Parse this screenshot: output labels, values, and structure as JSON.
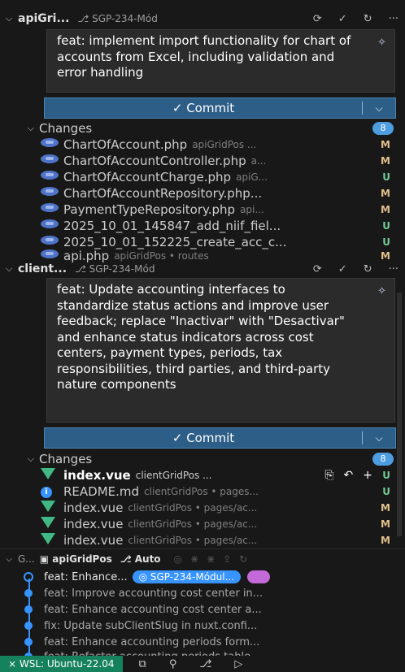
{
  "repos": [
    {
      "name": "apiGri...",
      "branch": "SGP-234-Mód",
      "commit_message": "feat: implement import functionality for chart of accounts from Excel, including validation and error handling",
      "commit_label": "Commit",
      "changes_label": "Changes",
      "changes_count": "8",
      "files": [
        {
          "name": "ChartOfAccount.php",
          "path": "apiGridPos ...",
          "status": "M"
        },
        {
          "name": "ChartOfAccountController.php",
          "path": "a...",
          "status": "M"
        },
        {
          "name": "ChartOfAccountCharge.php",
          "path": "apiG...",
          "status": "U"
        },
        {
          "name": "ChartOfAccountRepository.php...",
          "path": "",
          "status": "M"
        },
        {
          "name": "PaymentTypeRepository.php",
          "path": "api...",
          "status": "M"
        },
        {
          "name": "2025_10_01_145847_add_niif_fiel...",
          "path": "",
          "status": "U"
        },
        {
          "name": "2025_10_01_152225_create_acc_c...",
          "path": "",
          "status": "U"
        },
        {
          "name": "api.php",
          "path": "apiGridPos • routes",
          "status": "M"
        }
      ]
    },
    {
      "name": "client...",
      "branch": "SGP-234-Mód",
      "commit_message": "feat: Update accounting interfaces to standardize status actions and improve user feedback; replace \"Inactivar\" with \"Desactivar\" and enhance status indicators across cost centers, payment types, periods, tax responsibilities, third parties, and third-party nature components",
      "commit_label": "Commit",
      "changes_label": "Changes",
      "changes_count": "8",
      "files": [
        {
          "name": "index.vue",
          "path": "clientGridPos ...",
          "status": "U"
        },
        {
          "name": "README.md",
          "path": "clientGridPos • pages...",
          "status": "U"
        },
        {
          "name": "index.vue",
          "path": "clientGridPos • pages/ac...",
          "status": "M"
        },
        {
          "name": "index.vue",
          "path": "clientGridPos • pages/ac...",
          "status": "M"
        },
        {
          "name": "index.vue",
          "path": "clientGridPos • pages/ac...",
          "status": "M"
        }
      ]
    }
  ],
  "graph": {
    "header_prefix": "G...",
    "repo": "apiGridPos",
    "mode": "Auto",
    "commits": [
      {
        "text": "feat: Enhance...",
        "branch": "SGP-234-Módul..."
      },
      {
        "text": "feat: Improve accounting cost center in..."
      },
      {
        "text": "feat: Enhance accounting cost center a..."
      },
      {
        "text": "fix: Update subClientSlug in nuxt.confi..."
      },
      {
        "text": "feat: Enhance accounting periods form..."
      },
      {
        "text": "feat: Refactor accounting periods table..."
      }
    ]
  },
  "statusbar": {
    "remote": "WSL: Ubuntu-22.04"
  }
}
